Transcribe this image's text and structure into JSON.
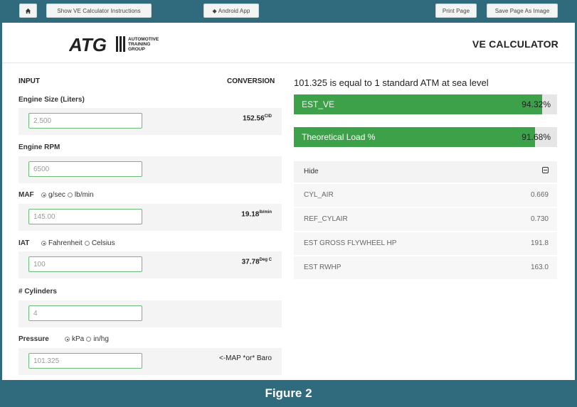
{
  "toolbar": {
    "home_icon": "home-icon",
    "instructions_label": "Show VE Calculator Instructions",
    "android_label": "Android App",
    "print_label": "Print Page",
    "save_image_label": "Save Page As Image"
  },
  "header": {
    "logo_text": "ATG",
    "logo_sub": [
      "AUTOMOTIVE",
      "TRAINING",
      "GROUP"
    ],
    "title": "VE CALCULATOR"
  },
  "left": {
    "input_header": "INPUT",
    "conversion_header": "CONVERSION",
    "engine_size": {
      "label": "Engine Size (Liters)",
      "value": "2.500",
      "conv_value": "152.56",
      "conv_unit": "CID"
    },
    "engine_rpm": {
      "label": "Engine RPM",
      "value": "6500"
    },
    "maf": {
      "label": "MAF",
      "opt1": "g/sec",
      "opt2": "lb/min",
      "value": "145.00",
      "conv_value": "19.18",
      "conv_unit": "lb/min"
    },
    "iat": {
      "label": "IAT",
      "opt1": "Fahrenheit",
      "opt2": "Celsius",
      "value": "100",
      "conv_value": "37.78",
      "conv_unit": "Deg C"
    },
    "cylinders": {
      "label": "# Cylinders",
      "value": "4"
    },
    "pressure": {
      "label": "Pressure",
      "opt1": "kPa",
      "opt2": "in/hg",
      "value": "101.325",
      "note": "<-MAP *or* Baro"
    }
  },
  "right": {
    "atm_note": "101.325 is equal to 1 standard ATM at sea level",
    "est_ve": {
      "label": "EST_VE",
      "value": "94.32%",
      "fraction": 0.9432
    },
    "theoretical_load": {
      "label": "Theoretical Load %",
      "value": "91.68%",
      "fraction": 0.9168
    },
    "hide_label": "Hide",
    "stats": [
      {
        "name": "CYL_AIR",
        "value": "0.669"
      },
      {
        "name": "REF_CYLAIR",
        "value": "0.730"
      },
      {
        "name": "EST GROSS FLYWHEEL HP",
        "value": "191.8"
      },
      {
        "name": "EST RWHP",
        "value": "163.0"
      }
    ]
  },
  "caption": "Figure 2",
  "colors": {
    "frame": "#2f6b7c",
    "bar": "#3da14a",
    "input_border": "#6dbb78"
  }
}
